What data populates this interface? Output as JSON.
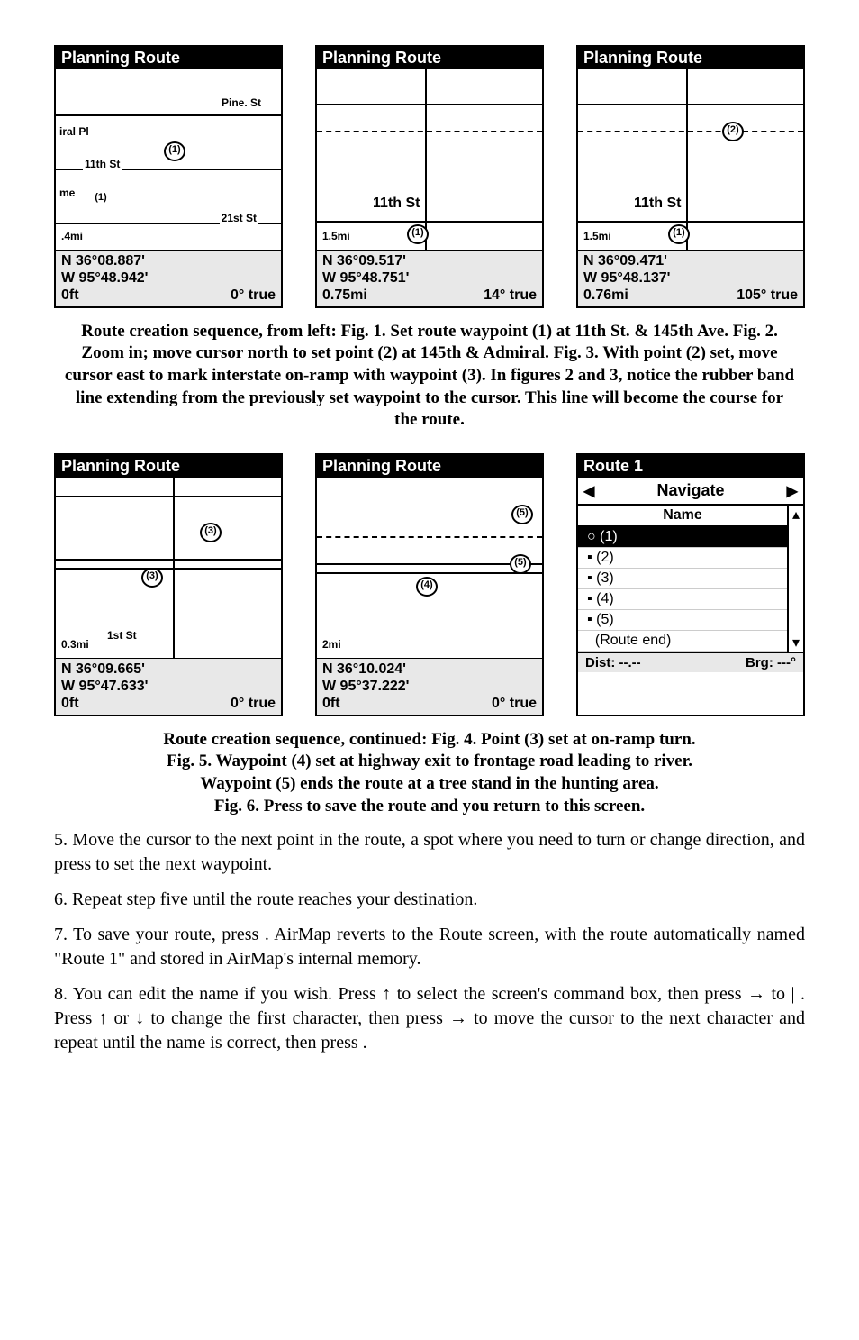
{
  "row1": {
    "screens": [
      {
        "title": "Planning Route",
        "map_labels": [
          "Pine. St",
          "iral Pl",
          "11th St",
          "me",
          "21st St",
          ".4mi"
        ],
        "waypoints": [
          "(1)",
          "(1)",
          "(1)"
        ],
        "coord_n": "N   36°08.887'",
        "coord_w": "W   95°48.942'",
        "dist": "0ft",
        "bearing": "0° true"
      },
      {
        "title": "Planning Route",
        "map_labels": [
          "11th St",
          "1.5mi"
        ],
        "waypoints": [
          "(1)"
        ],
        "coord_n": "N   36°09.517'",
        "coord_w": "W   95°48.751'",
        "dist": "0.75mi",
        "bearing": "14° true"
      },
      {
        "title": "Planning Route",
        "map_labels": [
          "11th St",
          "1.5mi"
        ],
        "waypoints": [
          "(2)",
          "(1)"
        ],
        "coord_n": "N   36°09.471'",
        "coord_w": "W   95°48.137'",
        "dist": "0.76mi",
        "bearing": "105° true"
      }
    ]
  },
  "caption1": "Route creation sequence, from left: Fig. 1. Set route waypoint (1) at 11th St. & 145th Ave. Fig. 2. Zoom in; move cursor north to set point (2) at 145th & Admiral. Fig. 3. With point (2) set, move cursor east to mark interstate on-ramp with waypoint (3). In figures 2 and 3, notice the rubber band line extending from the previously set waypoint to the cursor. This line will become the course for the route.",
  "row2": {
    "screens": [
      {
        "title": "Planning Route",
        "map_labels": [
          "1st St",
          "0.3mi"
        ],
        "waypoints": [
          "(3)",
          "(3)"
        ],
        "coord_n": "N   36°09.665'",
        "coord_w": "W   95°47.633'",
        "dist": "0ft",
        "bearing": "0° true"
      },
      {
        "title": "Planning Route",
        "map_labels": [
          "2mi"
        ],
        "waypoints": [
          "(5)",
          "(5)",
          "(4)"
        ],
        "coord_n": "N   36°10.024'",
        "coord_w": "W   95°37.222'",
        "dist": "0ft",
        "bearing": "0° true"
      }
    ],
    "route_screen": {
      "title": "Route 1",
      "nav_label": "Navigate",
      "col_header": "Name",
      "items": [
        "(1)",
        "(2)",
        "(3)",
        "(4)",
        "(5)",
        "(Route end)"
      ],
      "dist_label": "Dist: --.--",
      "brg_label": "Brg: ---°"
    }
  },
  "caption2_line1": "Route creation sequence, continued: Fig. 4. Point (3) set at on-ramp turn.",
  "caption2_line2": "Fig. 5. Waypoint (4) set at highway exit to frontage road leading to river.",
  "caption2_line3": "Waypoint (5) ends the route at a tree stand in the hunting area.",
  "caption2_line4": "Fig. 6. Press          to save the route and you return to this screen.",
  "step5": "5. Move the cursor to the next point in the route, a spot where you need to turn or change direction, and press          to set the next waypoint.",
  "step6": "6. Repeat step five until the route reaches your destination.",
  "step7": "7. To save your route, press        . AirMap reverts to the Route screen, with the route automatically named \"Route 1\" and stored in AirMap's internal memory.",
  "step8": "8. You can edit the name if you wish. Press ↑ to select the screen's command box, then press → to                |        . Press ↑ or ↓ to change the first character, then press → to move the cursor to the next character and repeat until the name is correct, then press        ."
}
